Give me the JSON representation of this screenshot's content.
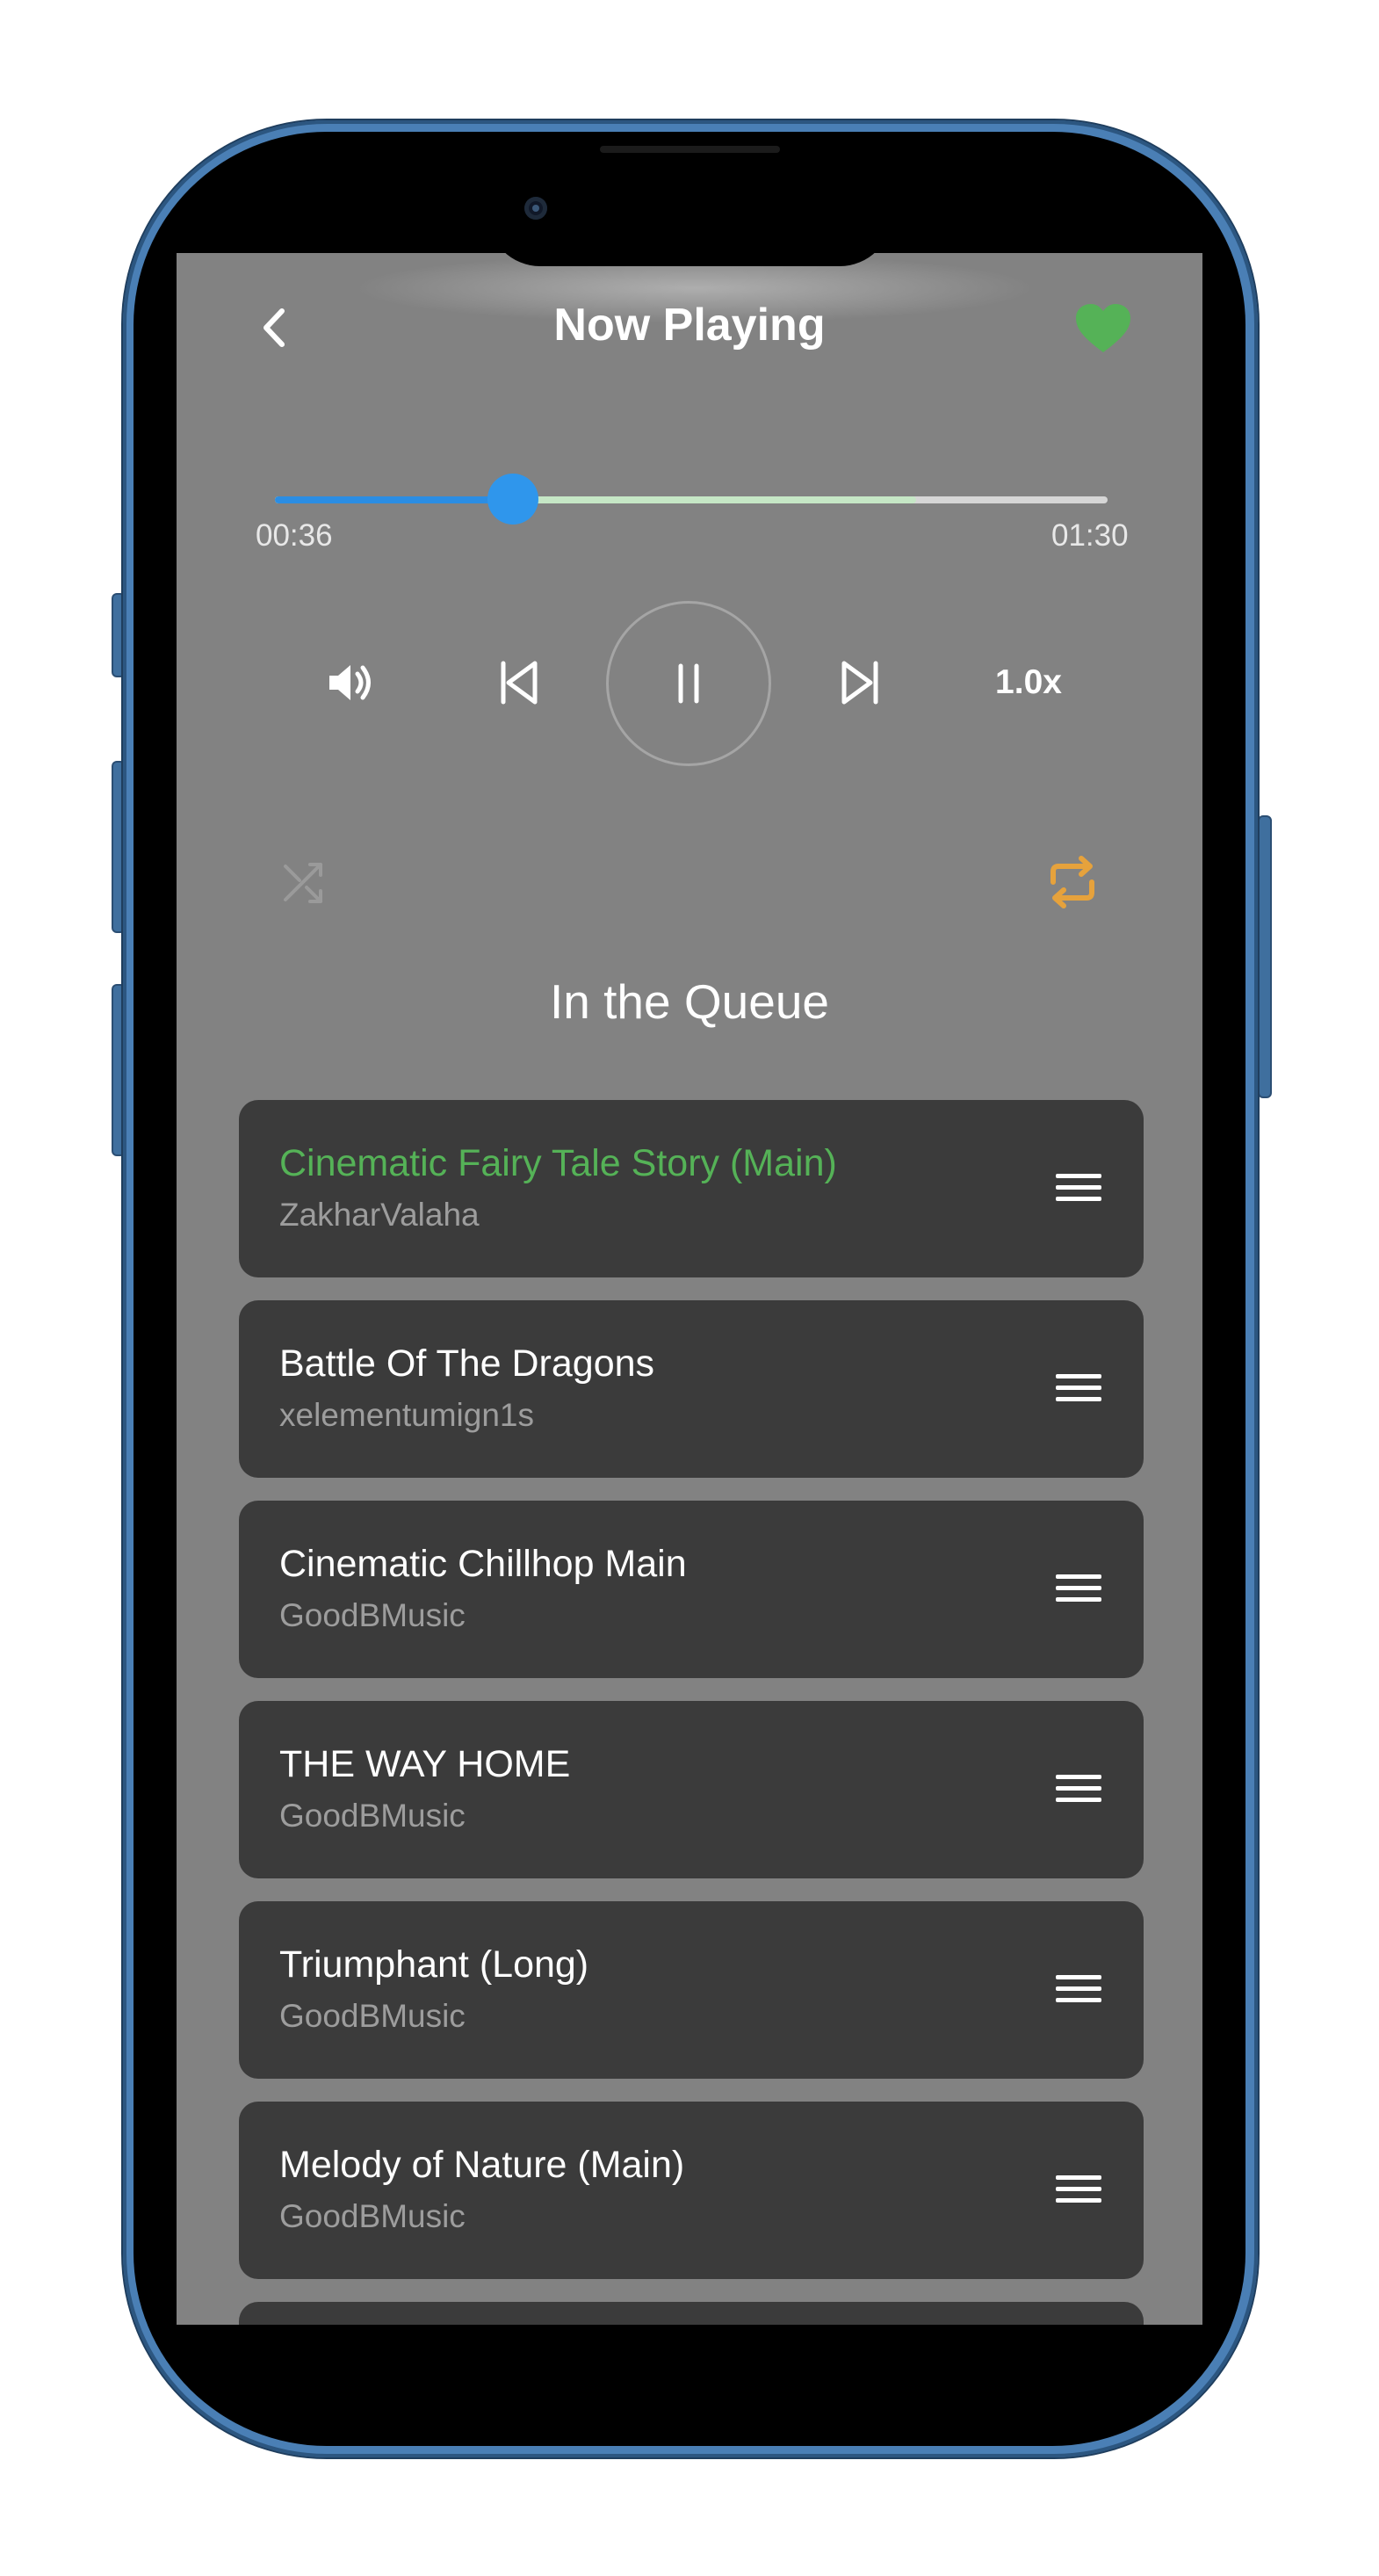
{
  "header": {
    "title": "Now Playing",
    "back_icon": "chevron-left-icon",
    "favorite_icon": "heart-icon",
    "favorite_color": "#55b257"
  },
  "player": {
    "elapsed": "00:36",
    "duration": "01:30",
    "played_fraction": 0.286,
    "buffered_fraction": 0.77,
    "speed_label": "1.0x",
    "controls": [
      "volume-icon",
      "previous-icon",
      "pause-icon",
      "next-icon"
    ],
    "shuffle_icon": "shuffle-icon",
    "repeat_icon": "repeat-icon",
    "repeat_color": "#e6a23c"
  },
  "queue": {
    "title": "In the Queue",
    "items": [
      {
        "title": "Cinematic Fairy Tale Story (Main)",
        "artist": "ZakharValaha",
        "active": true
      },
      {
        "title": "Battle Of The Dragons",
        "artist": "xelementumign1s",
        "active": false
      },
      {
        "title": "Cinematic Chillhop Main",
        "artist": "GoodBMusic",
        "active": false
      },
      {
        "title": "THE WAY HOME",
        "artist": "GoodBMusic",
        "active": false
      },
      {
        "title": "Triumphant (Long)",
        "artist": "GoodBMusic",
        "active": false
      },
      {
        "title": "Melody of Nature (Main)",
        "artist": "GoodBMusic",
        "active": false
      }
    ]
  },
  "colors": {
    "accent_blue": "#2f96ec",
    "active_green": "#55b257",
    "card": "#3b3b3b",
    "screen_bg": "#828282"
  }
}
